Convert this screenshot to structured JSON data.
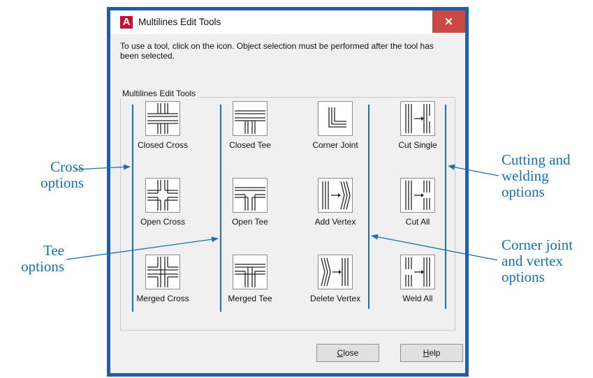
{
  "window": {
    "title": "Multilines Edit Tools",
    "app_icon_letter": "A",
    "close_glyph": "×"
  },
  "instructions": "To use a tool, click on the icon.  Object selection must be performed after the tool has been selected.",
  "group_label": "Multilines Edit Tools",
  "tools": {
    "closed_cross": "Closed Cross",
    "closed_tee": "Closed Tee",
    "corner_joint": "Corner Joint",
    "cut_single": "Cut Single",
    "open_cross": "Open Cross",
    "open_tee": "Open Tee",
    "add_vertex": "Add Vertex",
    "cut_all": "Cut All",
    "merged_cross": "Merged Cross",
    "merged_tee": "Merged Tee",
    "delete_vertex": "Delete Vertex",
    "weld_all": "Weld All"
  },
  "buttons": {
    "close_mnemonic": "C",
    "close_rest": "lose",
    "help_mnemonic": "H",
    "help_rest": "elp"
  },
  "annotations": {
    "cross_line1": "Cross",
    "cross_line2": "options",
    "tee_line1": "Tee",
    "tee_line2": "options",
    "cutting_line1": "Cutting and",
    "cutting_line2": "welding",
    "cutting_line3": "options",
    "corner_line1": "Corner joint",
    "corner_line2": "and vertex",
    "corner_line3": "options"
  },
  "colors": {
    "annotation_blue": "#1a6fb0",
    "window_border": "#1f5ea8",
    "close_button": "#c94a43",
    "app_icon": "#c8102e"
  },
  "icons": {
    "closed_cross": "closed-cross-icon",
    "closed_tee": "closed-tee-icon",
    "corner_joint": "corner-joint-icon",
    "cut_single": "cut-single-icon",
    "open_cross": "open-cross-icon",
    "open_tee": "open-tee-icon",
    "add_vertex": "add-vertex-icon",
    "cut_all": "cut-all-icon",
    "merged_cross": "merged-cross-icon",
    "merged_tee": "merged-tee-icon",
    "delete_vertex": "delete-vertex-icon",
    "weld_all": "weld-all-icon"
  }
}
